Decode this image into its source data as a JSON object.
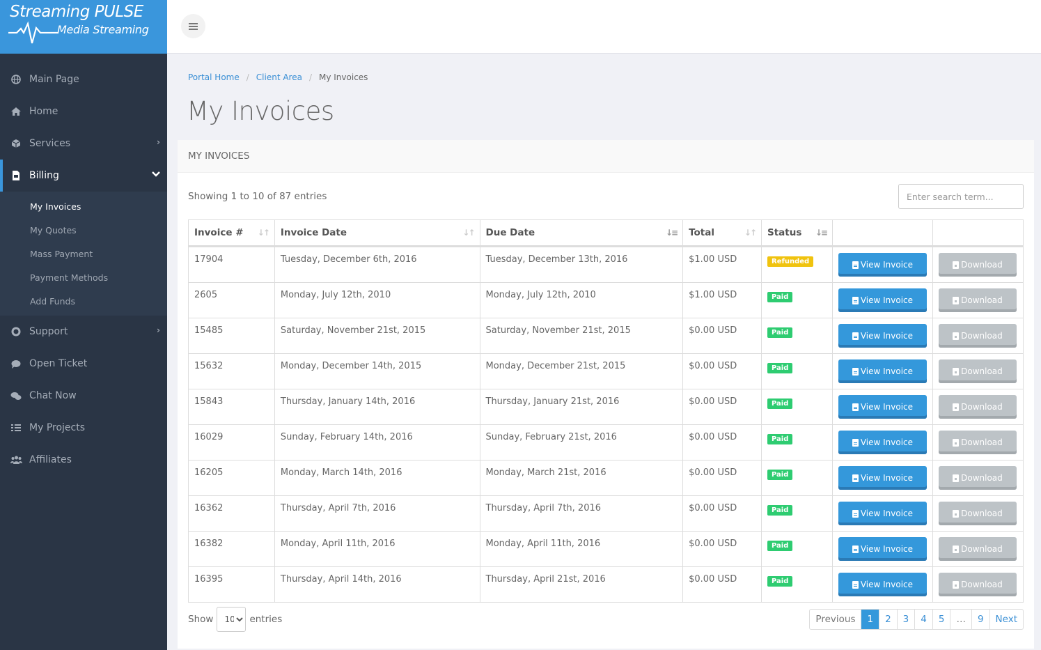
{
  "brand": {
    "line1": "Streaming PULSE",
    "line2": "Media Streaming",
    "color": "#3a96dc"
  },
  "sidebar": {
    "items": [
      {
        "label": "Main Page",
        "icon": "globe-icon"
      },
      {
        "label": "Home",
        "icon": "home-icon"
      },
      {
        "label": "Services",
        "icon": "cube-icon",
        "chevron": "›"
      },
      {
        "label": "Billing",
        "icon": "file-icon",
        "chevron": "⌄",
        "active": true
      },
      {
        "label": "Support",
        "icon": "life-ring-icon",
        "chevron": "›"
      },
      {
        "label": "Open Ticket",
        "icon": "comment-icon"
      },
      {
        "label": "Chat Now",
        "icon": "comments-icon"
      },
      {
        "label": "My Projects",
        "icon": "tasks-icon"
      },
      {
        "label": "Affiliates",
        "icon": "users-icon"
      }
    ],
    "billing_sub": [
      "My Invoices",
      "My Quotes",
      "Mass Payment",
      "Payment Methods",
      "Add Funds"
    ]
  },
  "breadcrumb": {
    "items": [
      "Portal Home",
      "Client Area",
      "My Invoices"
    ],
    "separator": "/"
  },
  "page_title": "My Invoices",
  "card_title": "MY INVOICES",
  "showing_text": "Showing 1 to 10 of 87 entries",
  "search": {
    "placeholder": "Enter search term..."
  },
  "table": {
    "headers": [
      "Invoice #",
      "Invoice Date",
      "Due Date",
      "Total",
      "Status",
      "",
      ""
    ],
    "view_label": "View Invoice",
    "download_label": "Download",
    "rows": [
      {
        "id": "17904",
        "date": "Tuesday, December 6th, 2016",
        "due": "Tuesday, December 13th, 2016",
        "total": "$1.00 USD",
        "status": "Refunded"
      },
      {
        "id": "2605",
        "date": "Monday, July 12th, 2010",
        "due": "Monday, July 12th, 2010",
        "total": "$1.00 USD",
        "status": "Paid"
      },
      {
        "id": "15485",
        "date": "Saturday, November 21st, 2015",
        "due": "Saturday, November 21st, 2015",
        "total": "$0.00 USD",
        "status": "Paid"
      },
      {
        "id": "15632",
        "date": "Monday, December 14th, 2015",
        "due": "Monday, December 21st, 2015",
        "total": "$0.00 USD",
        "status": "Paid"
      },
      {
        "id": "15843",
        "date": "Thursday, January 14th, 2016",
        "due": "Thursday, January 21st, 2016",
        "total": "$0.00 USD",
        "status": "Paid"
      },
      {
        "id": "16029",
        "date": "Sunday, February 14th, 2016",
        "due": "Sunday, February 21st, 2016",
        "total": "$0.00 USD",
        "status": "Paid"
      },
      {
        "id": "16205",
        "date": "Monday, March 14th, 2016",
        "due": "Monday, March 21st, 2016",
        "total": "$0.00 USD",
        "status": "Paid"
      },
      {
        "id": "16362",
        "date": "Thursday, April 7th, 2016",
        "due": "Thursday, April 7th, 2016",
        "total": "$0.00 USD",
        "status": "Paid"
      },
      {
        "id": "16382",
        "date": "Monday, April 11th, 2016",
        "due": "Monday, April 11th, 2016",
        "total": "$0.00 USD",
        "status": "Paid"
      },
      {
        "id": "16395",
        "date": "Thursday, April 14th, 2016",
        "due": "Thursday, April 21st, 2016",
        "total": "$0.00 USD",
        "status": "Paid"
      }
    ]
  },
  "footer": {
    "show_label": "Show",
    "entries_value": "10",
    "entries_label": "entries",
    "pagination": [
      "Previous",
      "1",
      "2",
      "3",
      "4",
      "5",
      "…",
      "9",
      "Next"
    ],
    "current_page": "1"
  },
  "colors": {
    "refunded": "#f0c30f",
    "paid": "#2ecc71",
    "primary": "#3498db"
  }
}
